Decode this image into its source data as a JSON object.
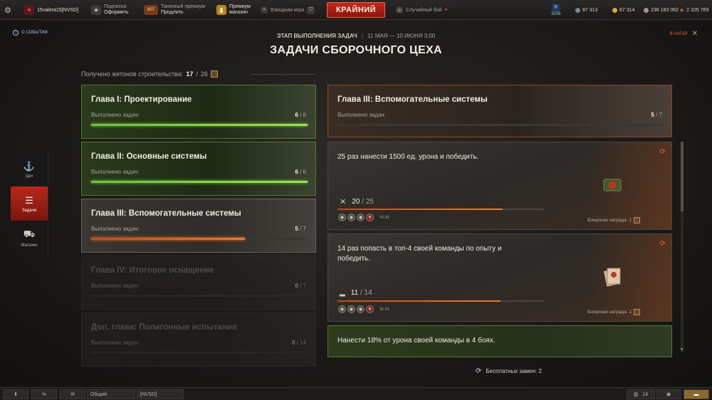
{
  "topbar": {
    "settings_icon": "gear-icon",
    "player_name": "15valera15[NVSD]",
    "subscription_label": "Подписка",
    "subscription_action": "Оформить",
    "premium_days": "807",
    "premium_label": "Танковый премиум",
    "premium_action": "Продлить",
    "premium_shop_label": "Премиум",
    "premium_shop_sub": "магазин",
    "squad_label": "Взводная игра",
    "battle_button": "КРАЙНИЙ",
    "mode_label": "Случайный бой",
    "clan_count": "3236",
    "free_xp": "87 313",
    "gold": "67 314",
    "credits": "236 183 062",
    "xp": "2 105 769"
  },
  "header": {
    "about_event": "О СОБЫТИИ",
    "stage_label": "ЭТАП ВЫПОЛНЕНИЯ ЗАДАЧ",
    "stage_dates": "11 МАЯ — 10 ИЮНЯ 3:00",
    "title": "ЗАДАЧИ СБОРОЧНОГО ЦЕХА",
    "to_hangar": "В АНГАР"
  },
  "tokens": {
    "label": "Получено жетонов строительства:",
    "current": "17",
    "separator": "/",
    "total": "26"
  },
  "sidebar": [
    {
      "label": "Цех",
      "icon": "crane-icon"
    },
    {
      "label": "Задачи",
      "icon": "tasks-icon"
    },
    {
      "label": "Магазин",
      "icon": "cart-icon"
    }
  ],
  "chapters": [
    {
      "name": "Глава I: Проектирование",
      "label": "Выполнено задач:",
      "done": "6",
      "total": "6",
      "progress": 1.0,
      "state": "done"
    },
    {
      "name": "Глава II: Основные системы",
      "label": "Выполнено задач:",
      "done": "6",
      "total": "6",
      "progress": 1.0,
      "state": "done"
    },
    {
      "name": "Глава III: Вспомогательные системы",
      "label": "Выполнено задач:",
      "done": "5",
      "total": "7",
      "progress": 0.71,
      "state": "active"
    },
    {
      "name": "Глава IV: Итоговое оснащение",
      "label": "Выполнено задач:",
      "done": "0",
      "total": "7",
      "progress": 0,
      "state": "locked"
    },
    {
      "name": "Доп. глава: Полигонные испытания",
      "label": "Выполнено задач:",
      "done": "0",
      "total": "14",
      "progress": 0,
      "state": "locked"
    }
  ],
  "detail": {
    "name": "Глава III: Вспомогательные системы",
    "label": "Выполнено задач:",
    "done": "5",
    "total": "7",
    "progress": 0.71
  },
  "tasks": [
    {
      "desc": "25 раз нанести 1500 ед. урона и победить.",
      "current": "20",
      "total": "25",
      "progress": 0.8,
      "tier": "VI-XI",
      "bonus": "Бонусная награда: 1",
      "icon": "crosshair-icon"
    },
    {
      "desc": "14 раз попасть в топ-4 своей команды по опыту и победить.",
      "current": "11",
      "total": "14",
      "progress": 0.79,
      "tier": "VI-XI",
      "bonus": "Бонусная награда: 1",
      "icon": "podium-icon"
    },
    {
      "desc": "Нанести 18% от урона своей команды в 4 боях."
    }
  ],
  "free_replacements": "Бесплатных замен: 2",
  "bottombar": {
    "chat_general": "Общий",
    "chat_clan": "[NVSD]",
    "online": "14"
  }
}
